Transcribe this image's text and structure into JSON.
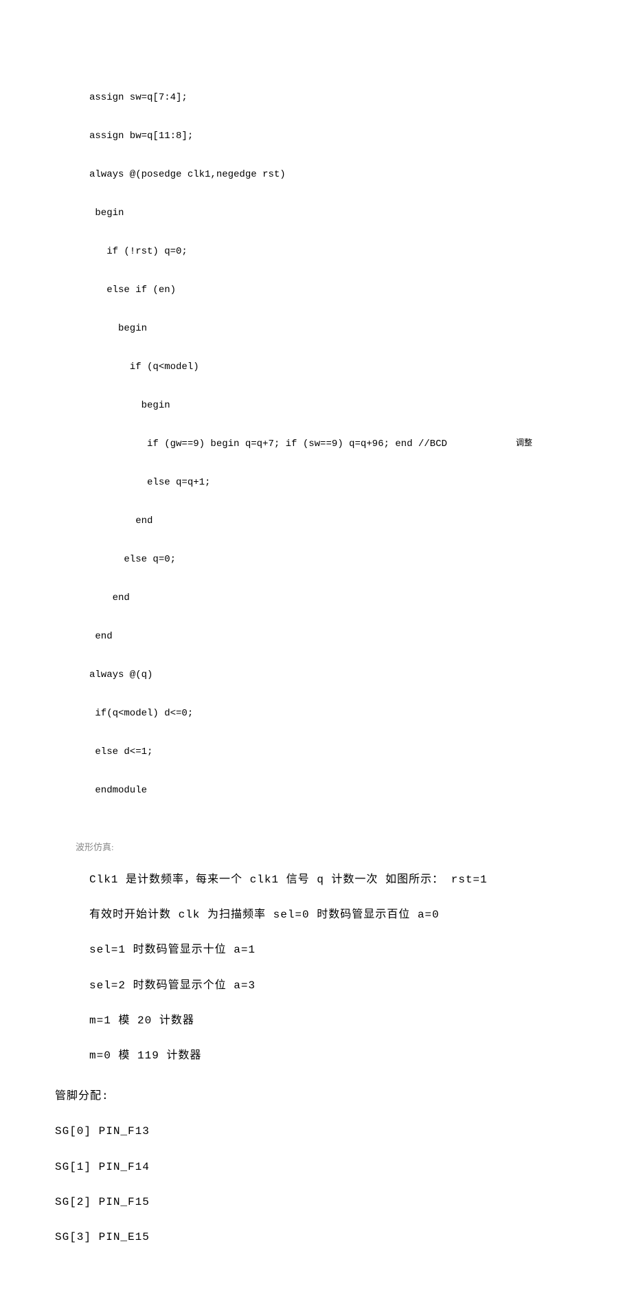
{
  "code": {
    "l1": "assign sw=q[7:4];",
    "l2": "assign bw=q[11:8];",
    "l3": "always @(posedge clk1,negedge rst)",
    "l4": " begin",
    "l5": "   if (!rst) q=0;",
    "l6": "   else if (en)",
    "l7": "     begin",
    "l8": "       if (q<model)",
    "l9": "         begin",
    "l10": "          if (gw==9) begin q=q+7; if (sw==9) q=q+96; end //BCD",
    "l10_comment": "调整",
    "l11": "          else q=q+1;",
    "l12": "        end",
    "l13": "      else q=0;",
    "l14": "    end",
    "l15": " end",
    "l16": "always @(q)",
    "l17": " if(q<model) d<=0;",
    "l18": " else d<=1;",
    "l19": " endmodule"
  },
  "sim_label": "波形仿真:",
  "desc": {
    "l1": "Clk1 是计数频率，每来一个 clk1 信号 q 计数一次 如图所示： rst=1",
    "l2": "有效时开始计数 clk 为扫描频率 sel=0 时数码管显示百位 a=0",
    "l3": "sel=1 时数码管显示十位 a=1",
    "l4": "sel=2 时数码管显示个位 a=3",
    "l5": "m=1 模 20 计数器",
    "l6": "m=0 模 119 计数器"
  },
  "pins": {
    "header": "管脚分配:",
    "p0": "SG[0] PIN_F13",
    "p1": "SG[1] PIN_F14",
    "p2": "SG[2] PIN_F15",
    "p3": "SG[3] PIN_E15"
  }
}
